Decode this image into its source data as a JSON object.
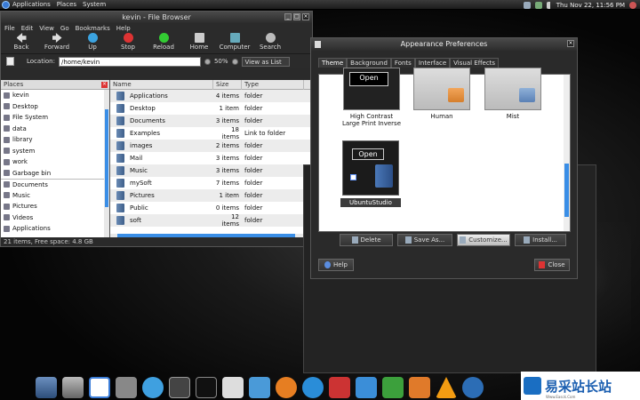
{
  "top_panel": {
    "menus": [
      "Applications",
      "Places",
      "System"
    ],
    "clock": "Thu Nov 22, 11:56 PM"
  },
  "file_browser": {
    "title": "kevin - File Browser",
    "menu": [
      "File",
      "Edit",
      "View",
      "Go",
      "Bookmarks",
      "Help"
    ],
    "toolbar": [
      "Back",
      "Forward",
      "Up",
      "Stop",
      "Reload",
      "Home",
      "Computer",
      "Search"
    ],
    "location_label": "Location:",
    "location_value": "/home/kevin",
    "zoom": "50%",
    "view_mode": "View as List",
    "places_header": "Places",
    "places": [
      "kevin",
      "Desktop",
      "File System",
      "data",
      "library",
      "system",
      "work",
      "Garbage bin"
    ],
    "bookmarks": [
      "Documents",
      "Music",
      "Pictures",
      "Videos",
      "Applications"
    ],
    "columns": [
      "Name",
      "Size",
      "Type"
    ],
    "rows": [
      {
        "name": "Applications",
        "size": "4 items",
        "type": "folder"
      },
      {
        "name": "Desktop",
        "size": "1 item",
        "type": "folder"
      },
      {
        "name": "Documents",
        "size": "3 items",
        "type": "folder"
      },
      {
        "name": "Examples",
        "size": "18 items",
        "type": "Link to folder"
      },
      {
        "name": "images",
        "size": "2 items",
        "type": "folder"
      },
      {
        "name": "Mail",
        "size": "3 items",
        "type": "folder"
      },
      {
        "name": "Music",
        "size": "3 items",
        "type": "folder"
      },
      {
        "name": "mySoft",
        "size": "7 items",
        "type": "folder"
      },
      {
        "name": "Pictures",
        "size": "1 item",
        "type": "folder"
      },
      {
        "name": "Public",
        "size": "0 items",
        "type": "folder"
      },
      {
        "name": "soft",
        "size": "12 items",
        "type": "folder"
      }
    ],
    "status": "21 items, Free space: 4.8 GB"
  },
  "appearance": {
    "title": "Appearance Preferences",
    "tabs": [
      "Theme",
      "Background",
      "Fonts",
      "Interface",
      "Visual Effects"
    ],
    "themes": [
      {
        "label": "High Contrast Large Print Inverse"
      },
      {
        "label": "Human"
      },
      {
        "label": "Mist"
      },
      {
        "label": "UbuntuStudio"
      }
    ],
    "sample_open": "Open",
    "actions": [
      "Delete",
      "Save As...",
      "Customize...",
      "Install..."
    ],
    "help": "Help",
    "close": "Close"
  },
  "watermark": {
    "text": "易采站长站",
    "sub": "Www.Easck.Com"
  }
}
